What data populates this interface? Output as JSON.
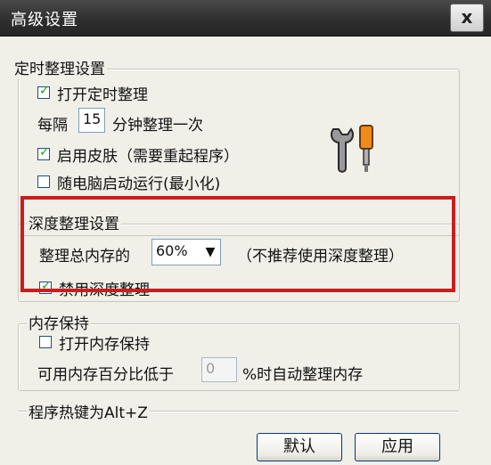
{
  "window": {
    "title": "高级设置",
    "close_label": "x"
  },
  "timer_group": {
    "legend": "定时整理设置",
    "enable_timer": {
      "label": "打开定时整理",
      "checked": true
    },
    "interval_prefix": "每隔",
    "interval_value": "15",
    "interval_suffix": "分钟整理一次",
    "enable_skin": {
      "label": "启用皮肤（需要重起程序）",
      "checked": true
    },
    "run_on_startup": {
      "label": "随电脑启动运行(最小化)",
      "checked": false
    }
  },
  "deep_group": {
    "legend": "深度整理设置",
    "memory_label": "整理总内存的",
    "memory_percent": "60%",
    "note": "（不推荐使用深度整理）",
    "disable_deep": {
      "label": "禁用深度整理",
      "checked": true
    }
  },
  "memory_keep_group": {
    "legend": "内存保持",
    "enable_keep": {
      "label": "打开内存保持",
      "checked": false
    },
    "threshold_prefix": "可用内存百分比低于",
    "threshold_value": "0",
    "threshold_suffix": "%时自动整理内存"
  },
  "hotkey_group": {
    "legend": "程序热键为Alt+Z"
  },
  "buttons": {
    "default_label": "默认",
    "apply_label": "应用"
  },
  "icons": {
    "tools": "wrench-screwdriver-icon"
  },
  "colors": {
    "highlight_frame": "#cc1d1d",
    "check": "#21a121"
  }
}
